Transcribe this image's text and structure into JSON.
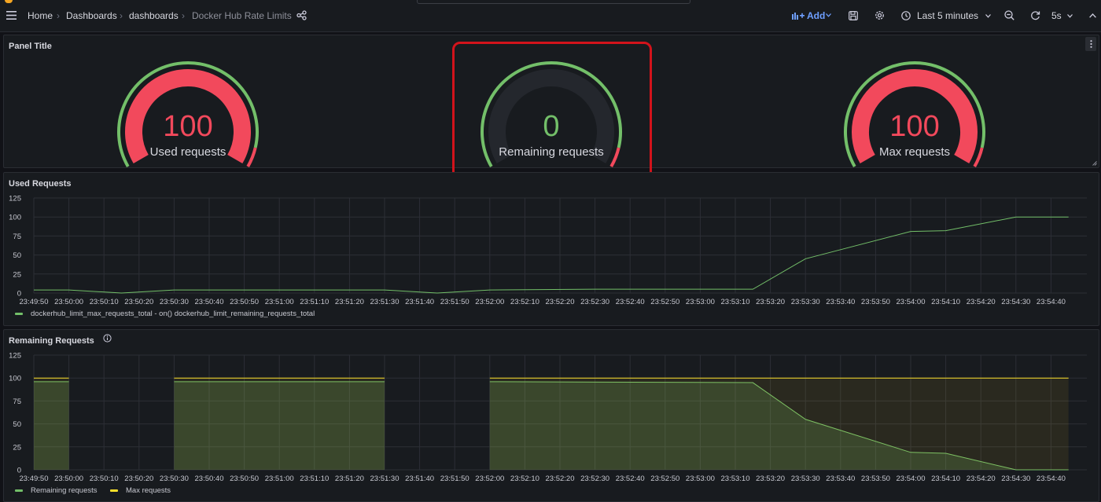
{
  "topbar": {
    "breadcrumb": [
      "Home",
      "Dashboards",
      "dashboards",
      "Docker Hub Rate Limits"
    ],
    "separator": "›",
    "add_label": "Add",
    "time_range": "Last 5 minutes",
    "refresh_interval": "5s"
  },
  "gauge_panel": {
    "title": "Panel Title",
    "gauges": [
      {
        "value": "100",
        "label": "Used requests",
        "fill_fraction": 1.0
      },
      {
        "value": "0",
        "label": "Remaining requests",
        "fill_fraction": 0.0
      },
      {
        "value": "100",
        "label": "Max requests",
        "fill_fraction": 1.0
      }
    ]
  },
  "used_panel": {
    "title": "Used Requests",
    "legend": [
      {
        "label": "dockerhub_limit_max_requests_total - on() dockerhub_limit_remaining_requests_total",
        "color": "#73bf69"
      }
    ]
  },
  "remaining_panel": {
    "title": "Remaining Requests",
    "legend": [
      {
        "label": "Remaining requests",
        "color": "#73bf69"
      },
      {
        "label": "Max requests",
        "color": "#fade2a"
      }
    ]
  },
  "colors": {
    "green": "#73bf69",
    "red": "#f2495c",
    "yellow": "#fade2a",
    "grid": "#2c2f36"
  },
  "chart_data": [
    {
      "type": "line",
      "title": "Used Requests",
      "ylim": [
        0,
        125
      ],
      "yticks": [
        0,
        25,
        50,
        75,
        100,
        125
      ],
      "xticks": [
        "23:49:50",
        "23:50:00",
        "23:50:10",
        "23:50:20",
        "23:50:30",
        "23:50:40",
        "23:50:50",
        "23:51:00",
        "23:51:10",
        "23:51:20",
        "23:51:30",
        "23:51:40",
        "23:51:50",
        "23:52:00",
        "23:52:10",
        "23:52:20",
        "23:52:30",
        "23:52:40",
        "23:52:50",
        "23:53:00",
        "23:53:10",
        "23:53:20",
        "23:53:30",
        "23:53:40",
        "23:53:50",
        "23:54:00",
        "23:54:10",
        "23:54:20",
        "23:54:30",
        "23:54:40"
      ],
      "series": [
        {
          "name": "dockerhub_limit_max_requests_total - on() dockerhub_limit_remaining_requests_total",
          "x": [
            "23:49:50",
            "23:50:00",
            "23:50:15",
            "23:50:30",
            "23:51:00",
            "23:51:30",
            "23:51:45",
            "23:52:00",
            "23:52:30",
            "23:53:00",
            "23:53:15",
            "23:53:30",
            "23:53:40",
            "23:54:00",
            "23:54:10",
            "23:54:30",
            "23:54:45"
          ],
          "values": [
            4,
            4,
            0,
            4,
            4,
            4,
            0,
            4,
            5,
            5,
            5,
            45,
            57,
            81,
            82,
            100,
            100
          ]
        }
      ]
    },
    {
      "type": "area",
      "title": "Remaining Requests",
      "ylim": [
        0,
        125
      ],
      "yticks": [
        0,
        25,
        50,
        75,
        100,
        125
      ],
      "xticks": [
        "23:49:50",
        "23:50:00",
        "23:50:10",
        "23:50:20",
        "23:50:30",
        "23:50:40",
        "23:50:50",
        "23:51:00",
        "23:51:10",
        "23:51:20",
        "23:51:30",
        "23:51:40",
        "23:51:50",
        "23:52:00",
        "23:52:10",
        "23:52:20",
        "23:52:30",
        "23:52:40",
        "23:52:50",
        "23:53:00",
        "23:53:10",
        "23:53:20",
        "23:53:30",
        "23:53:40",
        "23:53:50",
        "23:54:00",
        "23:54:10",
        "23:54:20",
        "23:54:30",
        "23:54:40"
      ],
      "series": [
        {
          "name": "Remaining requests",
          "segments": [
            {
              "x": [
                "23:49:50",
                "23:50:00"
              ],
              "values": [
                96,
                96
              ]
            },
            {
              "x": [
                "23:50:30",
                "23:51:30"
              ],
              "values": [
                96,
                96
              ]
            },
            {
              "x": [
                "23:52:00",
                "23:53:15",
                "23:53:30",
                "23:53:40",
                "23:54:00",
                "23:54:10",
                "23:54:30",
                "23:54:45"
              ],
              "values": [
                96,
                95,
                55,
                43,
                19,
                18,
                0,
                0
              ]
            }
          ]
        },
        {
          "name": "Max requests",
          "segments": [
            {
              "x": [
                "23:49:50",
                "23:50:00"
              ],
              "values": [
                100,
                100
              ]
            },
            {
              "x": [
                "23:50:30",
                "23:51:30"
              ],
              "values": [
                100,
                100
              ]
            },
            {
              "x": [
                "23:52:00",
                "23:54:45"
              ],
              "values": [
                100,
                100
              ]
            }
          ]
        }
      ]
    }
  ]
}
